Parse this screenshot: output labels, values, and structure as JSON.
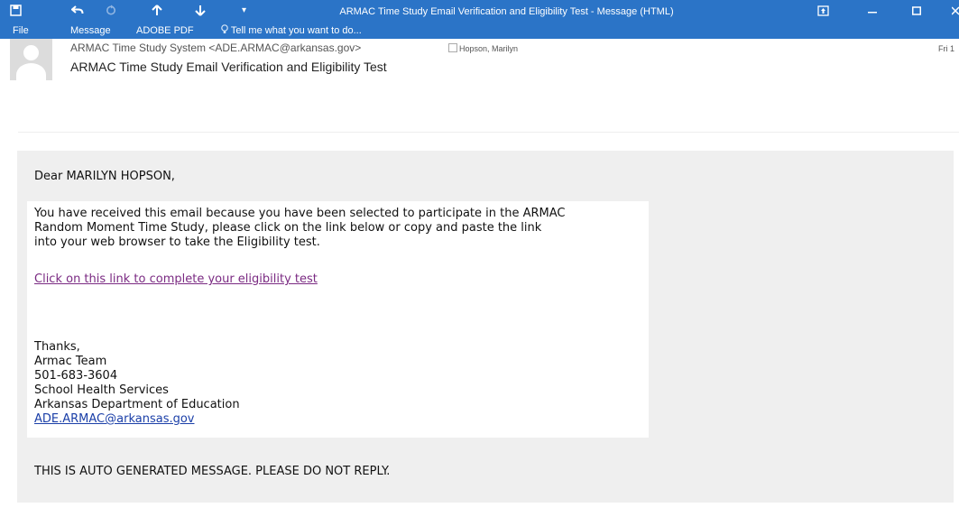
{
  "window": {
    "title": "ARMAC Time Study Email Verification and Eligibility Test - Message (HTML)",
    "icons": [
      "save-icon",
      "undo-icon",
      "redo-icon",
      "up-arrow-icon",
      "down-arrow-icon",
      "customize-icon",
      "restore-icon",
      "minimize-icon",
      "maximize-icon",
      "close-icon"
    ]
  },
  "ribbon": {
    "tabs": [
      "File",
      "Message",
      "ADOBE PDF"
    ],
    "tell_me": "Tell me what you want to do..."
  },
  "email": {
    "from": "ARMAC Time Study System <ADE.ARMAC@arkansas.gov>",
    "to": "Hopson, Marilyn",
    "date": "Fri 1",
    "subject": "ARMAC Time Study Email Verification and Eligibility Test"
  },
  "body": {
    "greeting": "Dear MARILYN HOPSON,",
    "paragraph_lines": [
      "You have received this email because you have been selected to participate in the ARMAC",
      "Random Moment Time Study, please click on the link below or copy and paste the link",
      "into your web browser to take the Eligibility test."
    ],
    "link_text": "Click on this link to complete your eligibility test",
    "signature": [
      "Thanks,",
      "Armac Team",
      "501-683-3604",
      "School Health Services",
      "Arkansas Department of Education"
    ],
    "email_link": "ADE.ARMAC@arkansas.gov",
    "footer": "THIS IS AUTO GENERATED MESSAGE. PLEASE DO NOT REPLY."
  },
  "colors": {
    "titlebar": "#2b74c7",
    "message_bg": "#efefef",
    "visited_link": "#7a2a82",
    "email_link": "#1b3fa8"
  }
}
